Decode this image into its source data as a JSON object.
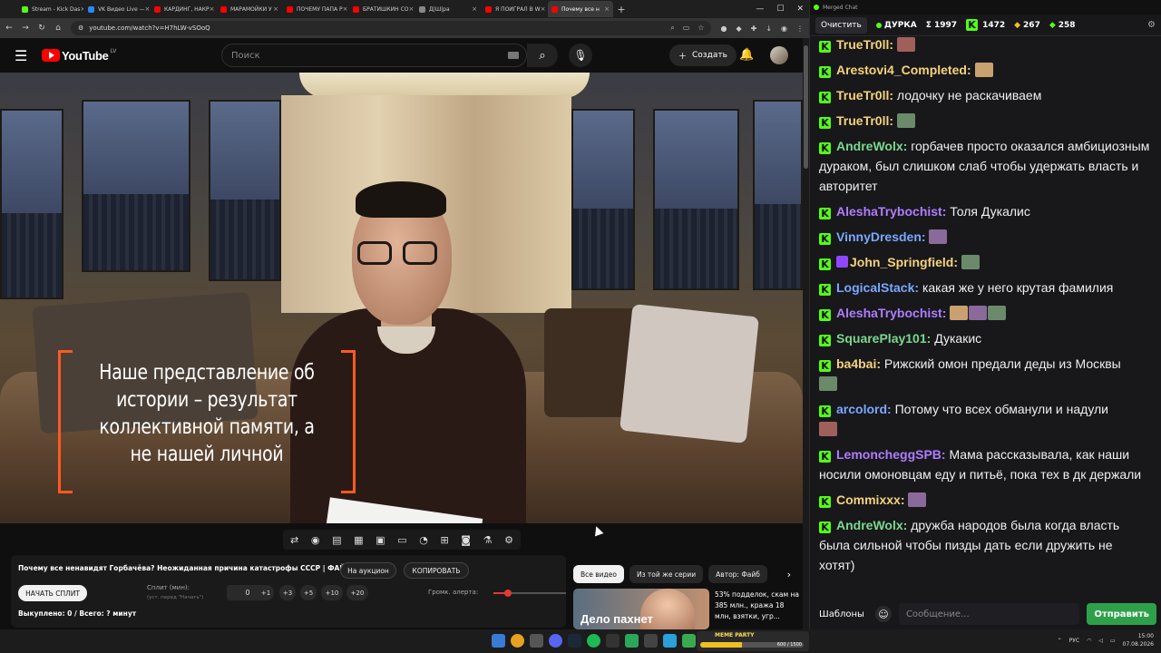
{
  "browser": {
    "tabs": [
      {
        "label": "Stream - Kick Das",
        "color": "#53fc18"
      },
      {
        "label": "VK Видео Live —",
        "color": "#2787f5"
      },
      {
        "label": "КАРДИНГ, НАКР",
        "color": "#ff0000"
      },
      {
        "label": "МАРАМОЙКИ У",
        "color": "#ff0000"
      },
      {
        "label": "ПОЧЕМУ ПАПА Р",
        "color": "#ff0000"
      },
      {
        "label": "БРАТИШКИН СО",
        "color": "#ff0000"
      },
      {
        "label": "Д|Ш|ра",
        "color": "#888888"
      },
      {
        "label": "Я ПОИГРАЛ В W",
        "color": "#ff0000"
      },
      {
        "label": "Почему все н",
        "color": "#ff0000",
        "active": true
      }
    ],
    "new_tab": "+",
    "url": "youtube.com/watch?v=H7hLW-vSOoQ"
  },
  "youtube": {
    "logo_text": "YouTube",
    "logo_region": "LV",
    "search_placeholder": "Поиск",
    "create_label": "Создать",
    "video_caption": "Наше представление об истории – результат коллективной памяти, а не нашей личной"
  },
  "panel": {
    "title": "Почему все ненавидят Горбачёва? Неожиданная причина катастрофы СССР | ФАЙБ",
    "auction_button": "На аукцион",
    "copy_button": "КОПИРОВАТЬ",
    "start_split_button": "НАЧАТЬ СПЛИТ",
    "split_label": "Сплит (мин):",
    "split_hint": "(уст. перед \"Начать\")",
    "split_value": "0",
    "steps": [
      "+1",
      "+3",
      "+5",
      "+10",
      "+20"
    ],
    "alert_volume_label": "Громк. алерта:",
    "alert_volume": 0.2,
    "sold_text": "Выкуплено: 0 / Всего: ? минут"
  },
  "related": {
    "chips": [
      "Все видео",
      "Из той же серии",
      "Автор: Файб"
    ],
    "thumb_text": "Дело пахнет",
    "title": "53% подделок, скам на 385 млн., кража 18 млн, взятки, угр..."
  },
  "widget": {
    "label": "MEME PARTY",
    "count": "600 / 1500",
    "progress": 0.4
  },
  "tray": {
    "lang": "РУС",
    "time": "15:00",
    "date": "07.08.2026"
  },
  "chat": {
    "window_title": "Merged Chat",
    "clear_button": "Очистить",
    "channel": "ДУРКА",
    "stats": {
      "sigma": "Σ 1997",
      "kick": "1472",
      "s2": "267",
      "s3": "258"
    },
    "messages": [
      {
        "platform": "kick",
        "user": "TrueTr0ll",
        "color": "#f5d37a",
        "text": "",
        "emotes": 1
      },
      {
        "platform": "kick",
        "user": "Arestovi4_Completed",
        "color": "#f5d37a",
        "text": "",
        "emotes": 1
      },
      {
        "platform": "kick",
        "user": "TrueTr0ll",
        "color": "#f5d37a",
        "text": "лодочку не раскачиваем",
        "emotes": 0
      },
      {
        "platform": "kick",
        "user": "TrueTr0ll",
        "color": "#f5d37a",
        "text": "",
        "emotes": 1
      },
      {
        "platform": "kick",
        "user": "AndreWolx",
        "color": "#7bd88f",
        "text": "горбачев просто оказался амбициозным дураком, был слишком слаб чтобы удержать власть и авторитет",
        "emotes": 0
      },
      {
        "platform": "kick",
        "user": "AleshaTrybochist",
        "color": "#b07cff",
        "text": "Толя Дукалис",
        "emotes": 0
      },
      {
        "platform": "kick",
        "user": "VinnyDresden",
        "color": "#7aa8ff",
        "text": "",
        "emotes": 1
      },
      {
        "platform": "kick",
        "user": "John_Springfield",
        "color": "#f5d37a",
        "text": "",
        "emotes": 1,
        "twitch": true
      },
      {
        "platform": "kick",
        "user": "LogicalStack",
        "color": "#7aa8ff",
        "text": "какая же у него крутая фамилия",
        "emotes": 0
      },
      {
        "platform": "kick",
        "user": "AleshaTrybochist",
        "color": "#b07cff",
        "text": "",
        "emotes": 3
      },
      {
        "platform": "kick",
        "user": "SquarePlay101",
        "color": "#7bd88f",
        "text": "Дукакис",
        "emotes": 0
      },
      {
        "platform": "kick",
        "user": "ba4bai",
        "color": "#f5d37a",
        "text": "Рижский омон предали деды из Москвы",
        "emotes": 1
      },
      {
        "platform": "kick",
        "user": "arcolord",
        "color": "#7aa8ff",
        "text": "Потому что всех обманули и надули",
        "emotes": 1
      },
      {
        "platform": "kick",
        "user": "LemoncheggSPB",
        "color": "#b07cff",
        "text": "Мама рассказывала, как наши носили омоновцам еду и питьё, пока тех в дк держали",
        "emotes": 0
      },
      {
        "platform": "kick",
        "user": "Commixxx",
        "color": "#f5d37a",
        "text": "",
        "emotes": 1
      },
      {
        "platform": "kick",
        "user": "AndreWolx",
        "color": "#7bd88f",
        "text": "дружба народов была когда власть была сильной чтобы пизды дать если дружить не хотят)",
        "emotes": 0
      }
    ],
    "templates_button": "Шаблоны",
    "input_placeholder": "Сообщение...",
    "send_button": "Отправить"
  }
}
